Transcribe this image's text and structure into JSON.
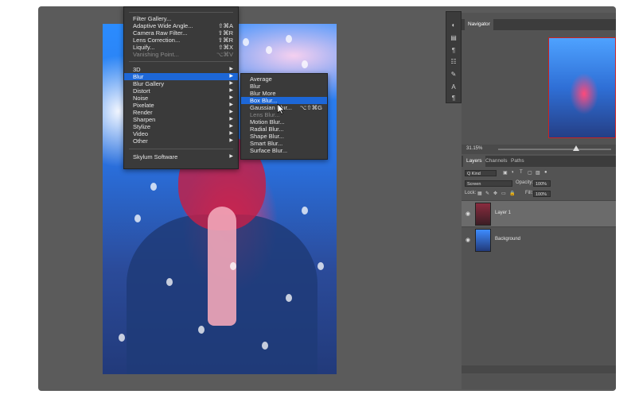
{
  "filter_menu": {
    "items": [
      {
        "label": "Filter Gallery...",
        "shortcut": ""
      },
      {
        "label": "Adaptive Wide Angle...",
        "shortcut": "⇧⌘A"
      },
      {
        "label": "Camera Raw Filter...",
        "shortcut": "⇧⌘R"
      },
      {
        "label": "Lens Correction...",
        "shortcut": "⇧⌘R"
      },
      {
        "label": "Liquify...",
        "shortcut": "⇧⌘X"
      },
      {
        "label": "Vanishing Point...",
        "shortcut": "⌥⌘V"
      }
    ],
    "submenus": [
      {
        "label": "3D"
      },
      {
        "label": "Blur"
      },
      {
        "label": "Blur Gallery"
      },
      {
        "label": "Distort"
      },
      {
        "label": "Noise"
      },
      {
        "label": "Pixelate"
      },
      {
        "label": "Render"
      },
      {
        "label": "Sharpen"
      },
      {
        "label": "Stylize"
      },
      {
        "label": "Video"
      },
      {
        "label": "Other"
      }
    ],
    "plugins": [
      {
        "label": "Skylum Software"
      }
    ]
  },
  "blur_menu": {
    "items": [
      {
        "label": "Average",
        "shortcut": ""
      },
      {
        "label": "Blur",
        "shortcut": ""
      },
      {
        "label": "Blur More",
        "shortcut": ""
      },
      {
        "label": "Box Blur...",
        "shortcut": ""
      },
      {
        "label": "Gaussian Blur...",
        "shortcut": "⌥⇧⌘G"
      },
      {
        "label": "Lens Blur...",
        "shortcut": ""
      },
      {
        "label": "Motion Blur...",
        "shortcut": ""
      },
      {
        "label": "Radial Blur...",
        "shortcut": ""
      },
      {
        "label": "Shape Blur...",
        "shortcut": ""
      },
      {
        "label": "Smart Blur...",
        "shortcut": ""
      },
      {
        "label": "Surface Blur...",
        "shortcut": ""
      }
    ]
  },
  "navigator": {
    "tab": "Navigator",
    "zoom": "31.15%"
  },
  "layers_panel": {
    "tabs": [
      "Layers",
      "Channels",
      "Paths"
    ],
    "filter_kind": "Q Kind",
    "blend_mode": "Screen",
    "opacity_label": "Opacity:",
    "opacity_value": "100%",
    "lock_label": "Lock:",
    "fill_label": "Fill:",
    "fill_value": "100%",
    "layers": [
      {
        "name": "Layer 1",
        "selected": true
      },
      {
        "name": "Background",
        "selected": false
      }
    ]
  },
  "colors": {
    "menu_highlight": "#1d67d7",
    "menu_bg": "#3a3a3a",
    "panel_bg": "#535353"
  }
}
